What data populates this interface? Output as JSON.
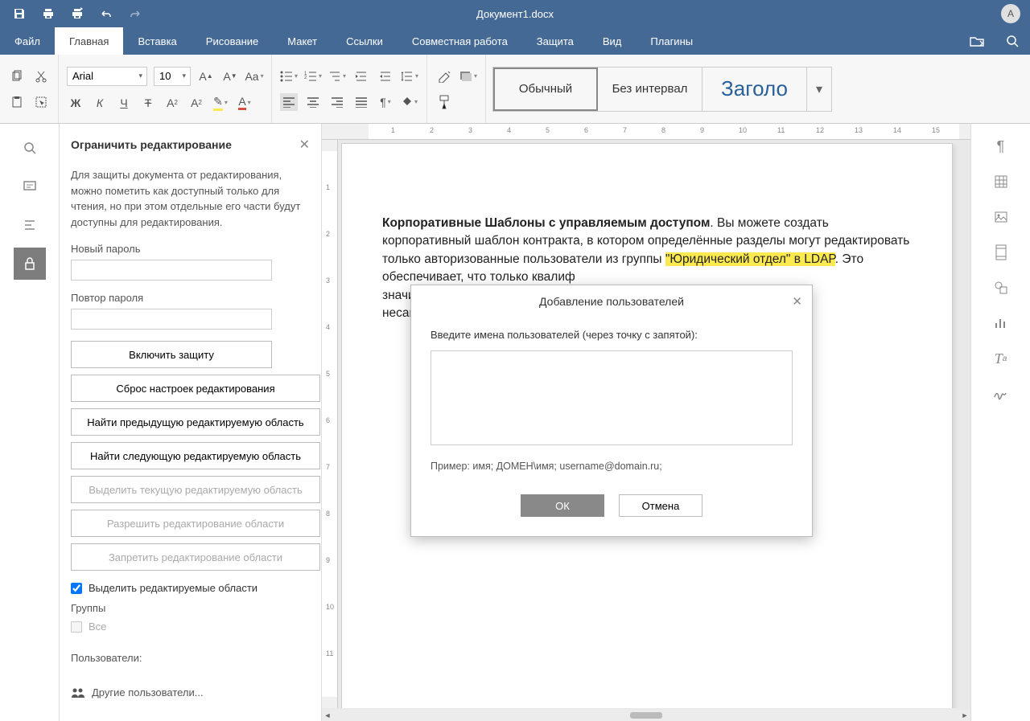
{
  "titlebar": {
    "title": "Документ1.docx",
    "avatar": "A"
  },
  "menubar": {
    "items": [
      "Файл",
      "Главная",
      "Вставка",
      "Рисование",
      "Макет",
      "Ссылки",
      "Совместная работа",
      "Защита",
      "Вид",
      "Плагины"
    ],
    "active": 1
  },
  "ribbon": {
    "font_name": "Arial",
    "font_size": "10",
    "styles": [
      "Обычный",
      "Без интервал",
      "Заголо"
    ]
  },
  "sidepanel": {
    "title": "Ограничить редактирование",
    "desc": "Для защиты документа от редактирования, можно пометить как доступный только для чтения, но при этом отдельные его части будут доступны для редактирования.",
    "new_password": "Новый пароль",
    "repeat_password": "Повтор пароля",
    "enable_protect": "Включить защиту",
    "reset_settings": "Сброс настроек редактирования",
    "find_prev": "Найти предыдущую редактируемую область",
    "find_next": "Найти следующую редактируемую область",
    "select_current": "Выделить текущую редактируемую область",
    "allow_region": "Разрешить редактирование области",
    "deny_region": "Запретить редактирование области",
    "highlight_chk": "Выделить редактируемые области",
    "groups_label": "Группы",
    "groups_all": "Все",
    "users_label": "Пользователи:",
    "other_users": "Другие пользователи..."
  },
  "document": {
    "bold_text": "Корпоративные Шаблоны с управляемым доступом",
    "body_before": ". Вы можете создать корпоративный шаблон контракта, в котором определённые разделы могут редактировать только авторизованные пользователи из группы ",
    "highlight": "\"Юридический отдел\" в LDAP",
    "body_after1": ". Это обеспечивает, что только квалиф",
    "body_after2": "значим",
    "body_after3": "несанк"
  },
  "dialog": {
    "title": "Добавление пользователей",
    "label": "Введите имена пользователей (через точку с запятой):",
    "hint": "Пример: имя; ДОМЕН\\имя; username@domain.ru;",
    "ok": "ОК",
    "cancel": "Отмена"
  },
  "ruler": {
    "h": [
      "1",
      "2",
      "3",
      "4",
      "5",
      "6",
      "7",
      "8",
      "9",
      "10",
      "11",
      "12",
      "13",
      "14",
      "15"
    ],
    "v": [
      "1",
      "2",
      "3",
      "4",
      "5",
      "6",
      "7",
      "8",
      "9",
      "10",
      "11"
    ]
  }
}
